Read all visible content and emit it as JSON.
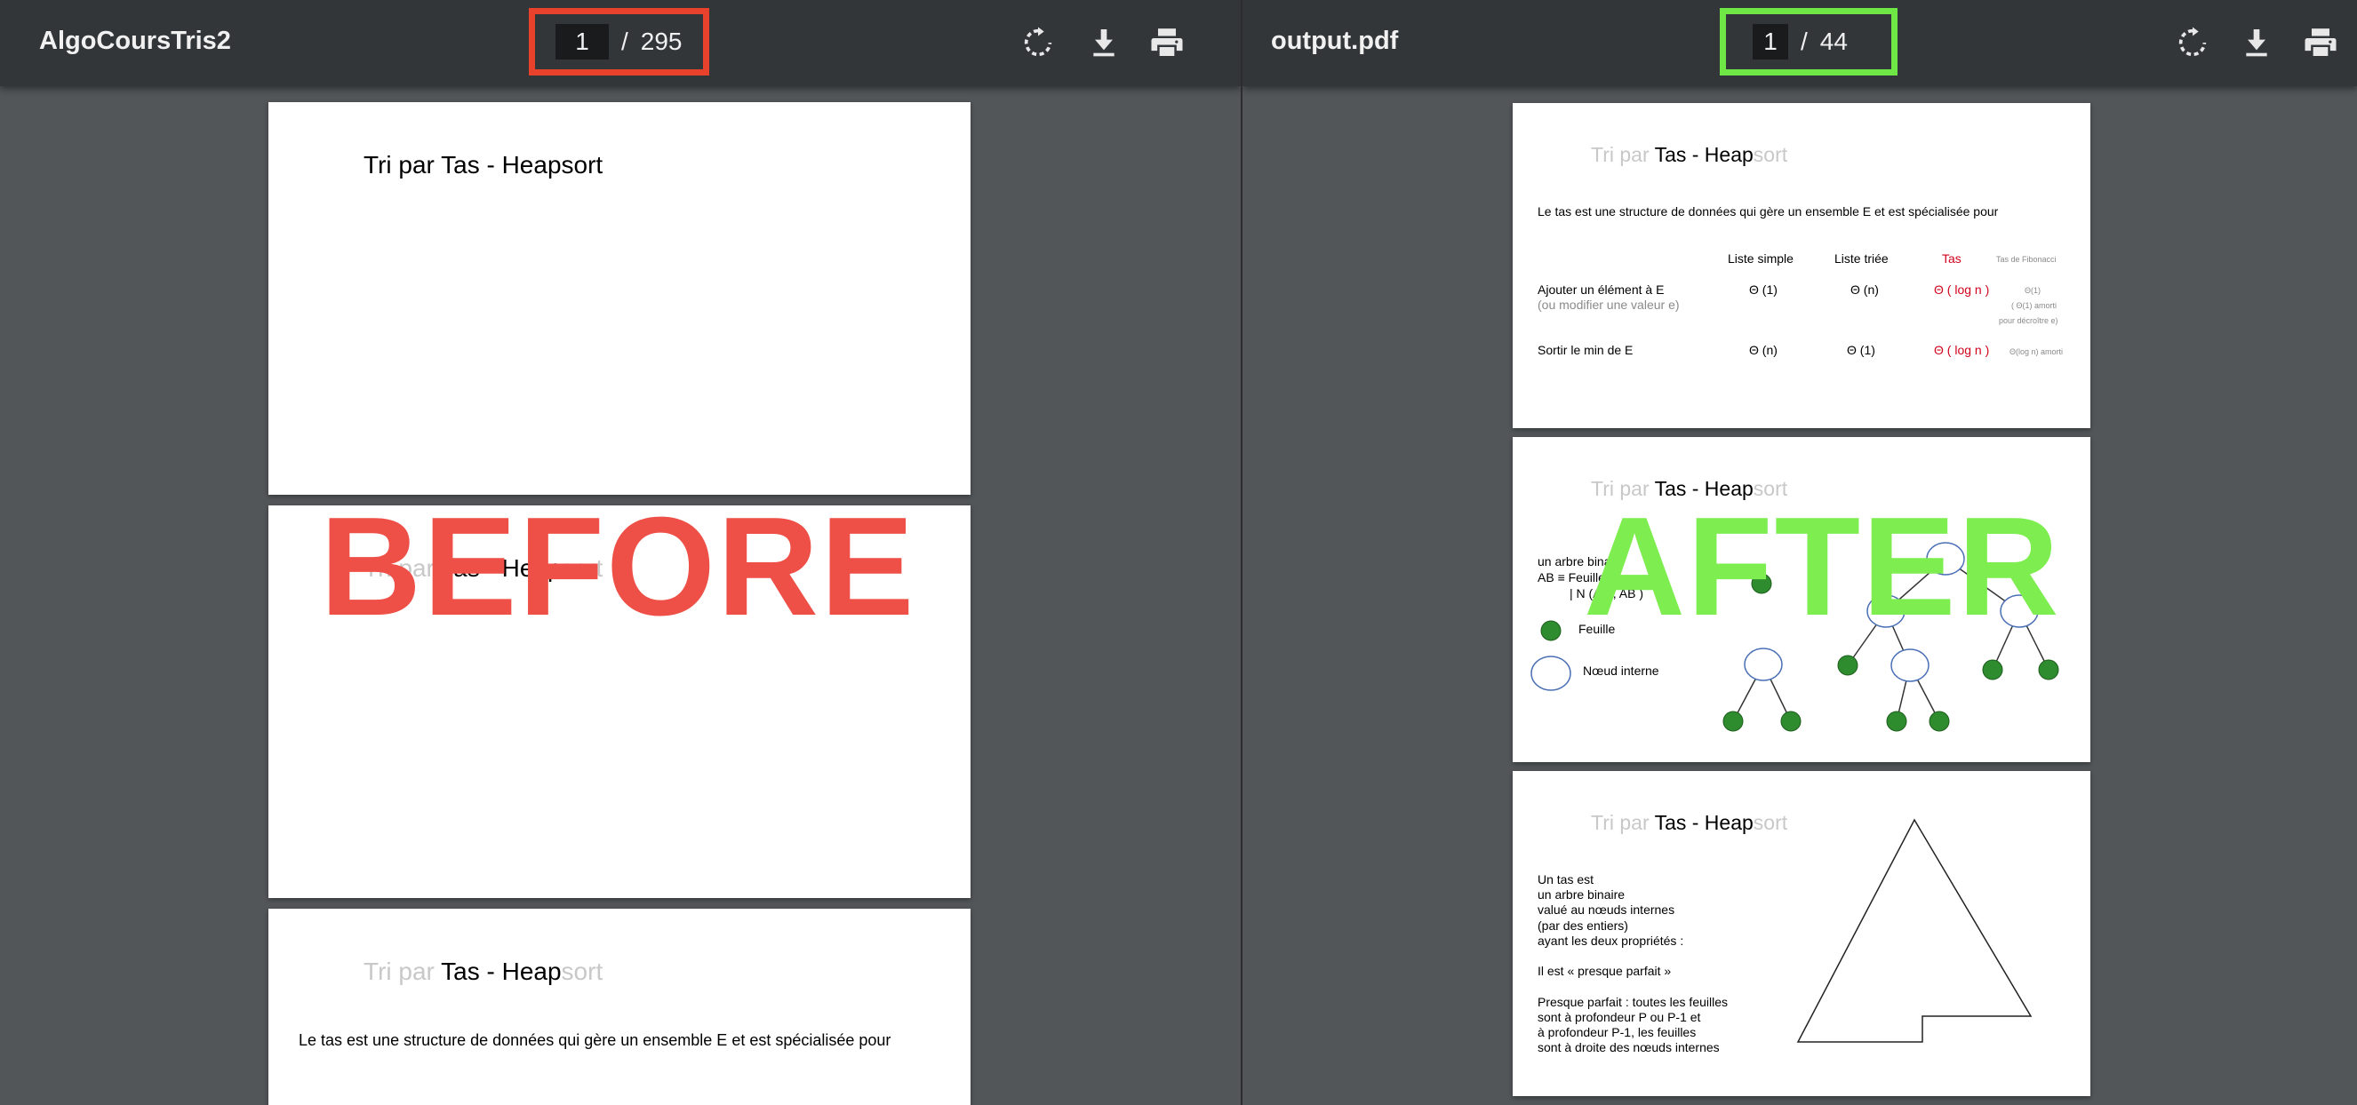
{
  "left_viewer": {
    "title": "AlgoCoursTris2",
    "page_current": "1",
    "page_separator": "/",
    "page_total": "295",
    "highlight_color": "#e8412c",
    "pages": [
      {
        "title": "Tri par Tas - Heapsort"
      },
      {
        "title_ghost_a": "Tri par ",
        "title_main": "Tas - Heap",
        "title_ghost_b": "sort"
      },
      {
        "title_ghost_a": "Tri par ",
        "title_main": "Tas - Heap",
        "title_ghost_b": "sort",
        "body": "Le tas est une structure de données qui gère un ensemble E et est spécialisée pour"
      }
    ],
    "overlay_label": "BEFORE",
    "overlay_color": "#ee4f46"
  },
  "right_viewer": {
    "title": "output.pdf",
    "page_current": "1",
    "page_separator": "/",
    "page_total": "44",
    "highlight_color": "#6ee646",
    "overlay_label": "AFTER",
    "overlay_color": "#7ded4f",
    "page1": {
      "title_ghost_a": "Tri par ",
      "title_main": "Tas - Heap",
      "title_ghost_b": "sort",
      "intro": "Le tas est une structure de données qui gère un ensemble E et est spécialisée pour",
      "columns": [
        "Liste simple",
        "Liste triée",
        "Tas",
        "Tas de Fibonacci"
      ],
      "row1_label": "Ajouter un élément à E",
      "row1_sub": "(ou modifier une valeur e)",
      "row1_values": [
        "Θ (1)",
        "Θ (n)",
        "Θ ( log n )"
      ],
      "row1_fib": [
        "Θ(1)",
        "( Θ(1) amorti",
        "pour décroître e)"
      ],
      "row2_label": "Sortir le min de E",
      "row2_values": [
        "Θ (n)",
        "Θ (1)",
        "Θ ( log n )"
      ],
      "row2_fib": "Θ(log n) amorti"
    },
    "page2": {
      "title_ghost_a": "Tri par ",
      "title_main": "Tas - Heap",
      "title_ghost_b": "sort",
      "line1": "un arbre binaire",
      "line2": "AB ≡  Feuille",
      "line3": "| N (AB , AB )",
      "legend_leaf": "Feuille",
      "legend_node": "Nœud interne",
      "leaf_color": "#2e8b2e",
      "node_stroke": "#4a6fb5"
    },
    "page3": {
      "title_ghost_a": "Tri par ",
      "title_main": "Tas - Heap",
      "title_ghost_b": "sort",
      "lines": [
        "Un tas est",
        "un arbre binaire",
        "valué au nœuds internes",
        "(par des entiers)",
        "ayant les deux propriétés :",
        "",
        "Il est « presque parfait »",
        "",
        "Presque parfait : toutes les feuilles",
        "sont à profondeur P ou P-1 et",
        "à profondeur P-1, les feuilles",
        "sont à droite des nœuds internes"
      ]
    }
  },
  "icons": [
    "rotate-icon",
    "download-icon",
    "print-icon"
  ]
}
